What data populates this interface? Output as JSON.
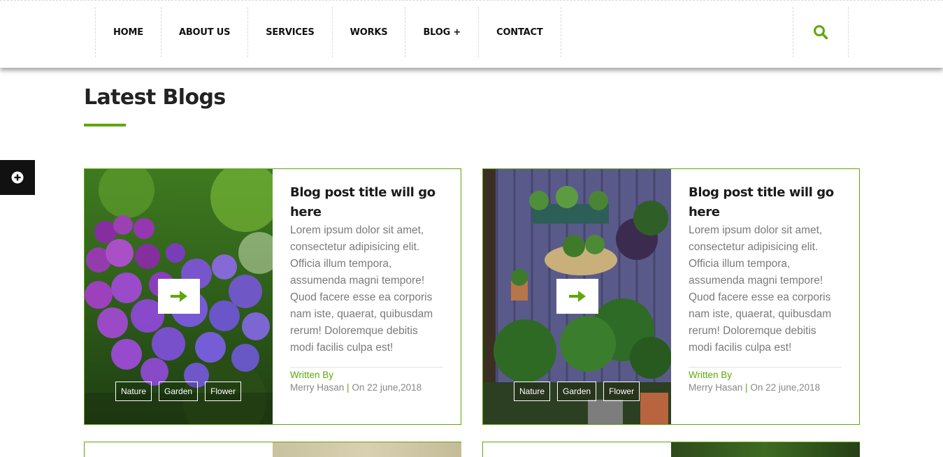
{
  "nav": {
    "items": [
      "HOME",
      "ABOUT US",
      "SERVICES",
      "WORKS",
      "BLOG +",
      "CONTACT"
    ]
  },
  "section": {
    "title": "Latest Blogs"
  },
  "posts": [
    {
      "title": "Blog post title will go here",
      "excerpt": "Lorem ipsum dolor sit amet, consectetur adipisicing elit. Officia illum tempora, assumenda magni tempore! Quod facere esse ea corporis nam iste, quaerat, quibusdam rerum! Doloremque debitis modi facilis culpa est!",
      "written_by": "Written By",
      "author": "Merry Hasan",
      "date": "On 22 june,2018",
      "tags": [
        "Nature",
        "Garden",
        "Flower"
      ]
    },
    {
      "title": "Blog post title will go here",
      "excerpt": "Lorem ipsum dolor sit amet, consectetur adipisicing elit. Officia illum tempora, assumenda magni tempore! Quod facere esse ea corporis nam iste, quaerat, quibusdam rerum! Doloremque debitis modi facilis culpa est!",
      "written_by": "Written By",
      "author": "Merry Hasan",
      "date": "On 22 june,2018",
      "tags": [
        "Nature",
        "Garden",
        "Flower"
      ]
    }
  ],
  "colors": {
    "accent": "#5fa80c",
    "text_dark": "#1b1b1b",
    "text_muted": "#7a7a7a"
  },
  "icons": {
    "search": "search-icon",
    "side_toggle": "plus-circle-icon",
    "arrow": "arrow-right-icon"
  }
}
